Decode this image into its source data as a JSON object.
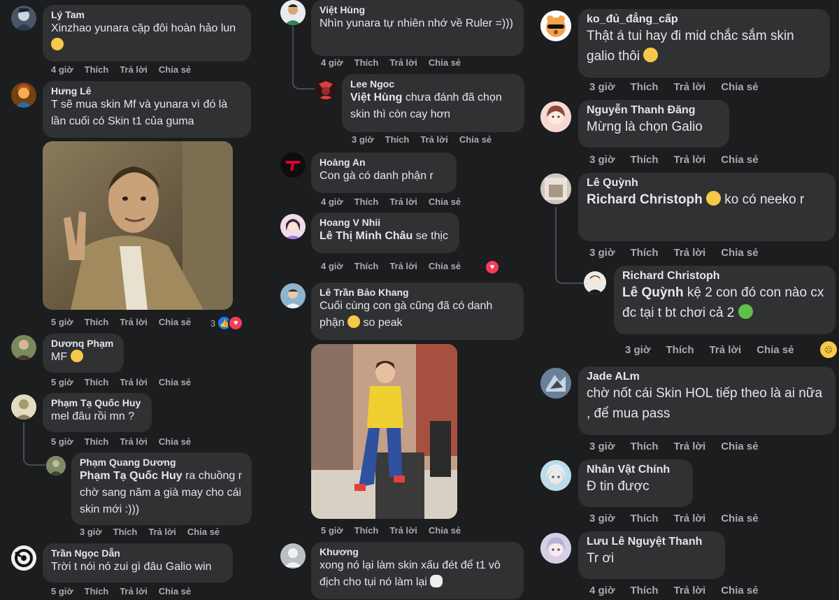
{
  "actions": {
    "like": "Thích",
    "reply": "Trả lời",
    "share": "Chia sẻ"
  },
  "col1": [
    {
      "name": "Lý Tam",
      "text": "Xinzhao yunara cặp đôi hoàn hảo lun",
      "time": "4 giờ"
    },
    {
      "name": "Hưng Lê",
      "text": "T sẽ mua skin Mf và yunara vì đó là lần cuối có Skin t1 của guma",
      "time": "5 giờ",
      "reaction_count": "3"
    },
    {
      "name": "Dươnq Phạm",
      "text": "MF",
      "time": "5 giờ"
    },
    {
      "name": "Phạm Tạ Quốc Huy",
      "text": "mel đâu rồi mn ?",
      "time": "5 giờ"
    },
    {
      "name": "Phạm Quang Dương",
      "mention": "Phạm Tạ Quốc Huy",
      "text": " ra chuồng r chờ sang năm a già may cho cái skin mới :)))",
      "time": "3 giờ"
    },
    {
      "name": "Trần Ngọc Dẫn",
      "text": "Trời t nói nó zui gì đâu Galio win",
      "time": "5 giờ"
    }
  ],
  "col2": [
    {
      "name": "Việt Hùng",
      "text": "Nhìn yunara tự nhiên nhớ về Ruler =)))",
      "time": "4 giờ"
    },
    {
      "name": "Lee Ngoc",
      "mention": "Việt Hùng",
      "text": " chưa đánh đã chọn skin thì còn cay hơn",
      "time": "3 giờ"
    },
    {
      "name": "Hoàng An",
      "text": "Con gà có danh phận r",
      "time": "4 giờ"
    },
    {
      "name": "Hoang V Nhii",
      "mention": "Lê Thị Minh Châu",
      "text": " se thịc",
      "time": "4 giờ"
    },
    {
      "name": "Lê Trần Bảo Khang",
      "text": "Cuối cùng con gà cũng đã có danh phận",
      "text2": " so peak",
      "time": "5 giờ"
    },
    {
      "name": "Khương",
      "text": "xong nó lại làm skin xấu đét để t1 vô địch cho tụi nó làm lại",
      "time": ""
    }
  ],
  "col3": [
    {
      "name": "ko_đủ_đẳng_cấp",
      "text": "Thật á tui hay đi mid chắc sắm skin galio thôi",
      "time": "3 giờ"
    },
    {
      "name": "Nguyễn Thanh Đăng",
      "text": "Mừng là chọn Galio",
      "time": "3 giờ"
    },
    {
      "name": "Lê Quỳnh",
      "mention": "Richard Christoph",
      "text": " ko có neeko r",
      "time": "3 giờ"
    },
    {
      "name": "Richard Christoph",
      "mention": "Lê Quỳnh",
      "text": " kệ 2 con đó con nào cx đc tại t bt chơi cả 2",
      "time": "3 giờ"
    },
    {
      "name": "Jade ALm",
      "text": "chờ nốt cái Skin HOL tiếp theo là ai nữa , để mua pass",
      "time": "3 giờ"
    },
    {
      "name": "Nhân Vật Chính",
      "text": "Đ tin được",
      "time": "3 giờ"
    },
    {
      "name": "Lưu Lê Nguyệt Thanh",
      "text": "Tr ơi",
      "time": "4 giờ"
    }
  ],
  "colors": {
    "background": "#1c1d1f",
    "bubble": "#303133",
    "text": "#e4e6eb",
    "meta": "#a8abaf",
    "like_blue": "#1877f2",
    "love_red": "#f33e58"
  }
}
